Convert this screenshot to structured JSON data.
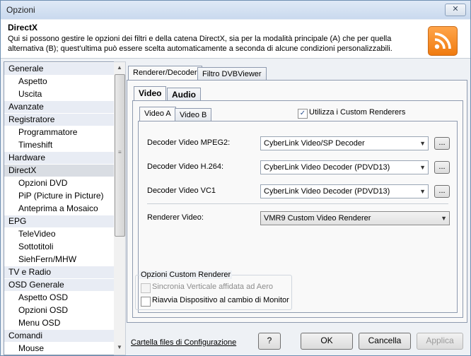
{
  "window": {
    "title": "Opzioni",
    "close_symbol": "✕"
  },
  "header": {
    "title": "DirectX",
    "description": "Qui si possono gestire le opzioni dei filtri e della catena DirectX, sia per la modalità principale (A) che per quella alternativa (B); quest'ultima può essere scelta automaticamente a seconda di alcune condizioni personalizzabili.",
    "icon": "rss-feed-icon"
  },
  "sidebar": {
    "items": [
      {
        "label": "Generale",
        "type": "category"
      },
      {
        "label": "Aspetto",
        "type": "sub"
      },
      {
        "label": "Uscita",
        "type": "sub"
      },
      {
        "label": "Avanzate",
        "type": "category"
      },
      {
        "label": "Registratore",
        "type": "category"
      },
      {
        "label": "Programmatore",
        "type": "sub"
      },
      {
        "label": "Timeshift",
        "type": "sub"
      },
      {
        "label": "Hardware",
        "type": "category"
      },
      {
        "label": "DirectX",
        "type": "category",
        "selected": true
      },
      {
        "label": "Opzioni DVD",
        "type": "sub"
      },
      {
        "label": "PiP (Picture in Picture)",
        "type": "sub"
      },
      {
        "label": "Anteprima a Mosaico",
        "type": "sub"
      },
      {
        "label": "EPG",
        "type": "category"
      },
      {
        "label": "TeleVideo",
        "type": "sub"
      },
      {
        "label": "Sottotitoli",
        "type": "sub"
      },
      {
        "label": "SiehFern/MHW",
        "type": "sub"
      },
      {
        "label": "TV e Radio",
        "type": "category"
      },
      {
        "label": "OSD Generale",
        "type": "category"
      },
      {
        "label": "Aspetto OSD",
        "type": "sub"
      },
      {
        "label": "Opzioni OSD",
        "type": "sub"
      },
      {
        "label": "Menu OSD",
        "type": "sub"
      },
      {
        "label": "Comandi",
        "type": "category"
      },
      {
        "label": "Mouse",
        "type": "sub"
      }
    ]
  },
  "tabs_top": [
    "Renderer/Decoder",
    "Filtro DVBViewer"
  ],
  "tabs_media": [
    "Video",
    "Audio"
  ],
  "tabs_mode": [
    "Video A",
    "Video B"
  ],
  "custom_renderers": {
    "label": "Utilizza i Custom Renderers",
    "checked": true,
    "mark": "✓"
  },
  "decoders": [
    {
      "label": "Decoder Video MPEG2:",
      "value": "CyberLink Video/SP Decoder",
      "btn": "..."
    },
    {
      "label": "Decoder Video H.264:",
      "value": "CyberLink Video Decoder (PDVD13)",
      "btn": "..."
    },
    {
      "label": "Decoder Video VC1",
      "value": "CyberLink Video Decoder (PDVD13)",
      "btn": "..."
    }
  ],
  "renderer": {
    "label": "Renderer Video:",
    "value": "VMR9 Custom Video Renderer"
  },
  "custom_renderer_options": {
    "title": "Opzioni Custom Renderer",
    "options": [
      {
        "label": "Sincronia Verticale affidata ad Aero",
        "enabled": false,
        "checked": false
      },
      {
        "label": "Riavvia Dispositivo al cambio di Monitor",
        "enabled": true,
        "checked": false
      }
    ]
  },
  "footer": {
    "config_link": "Cartella files di Configurazione",
    "help": "?",
    "ok": "OK",
    "cancel": "Cancella",
    "apply": "Applica"
  }
}
